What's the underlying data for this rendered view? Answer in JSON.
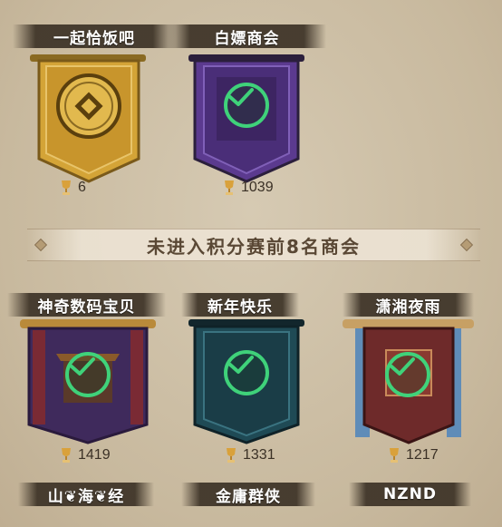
{
  "top_guilds": [
    {
      "name": "一起恰饭吧",
      "score": "6",
      "banner": "gold-coin-banner",
      "selected": false
    },
    {
      "name": "白嫖商会",
      "score": "1039",
      "banner": "purple-banner",
      "selected": true
    }
  ],
  "divider": {
    "text": "未进入积分赛前8名商会"
  },
  "other_guilds": [
    {
      "name": "神奇数码宝贝",
      "score": "1419",
      "banner": "purple-red-pavilion-banner",
      "selected": true
    },
    {
      "name": "新年快乐",
      "score": "1331",
      "banner": "teal-banner",
      "selected": true
    },
    {
      "name": "潇湘夜雨",
      "score": "1217",
      "banner": "red-blue-banner",
      "selected": true
    }
  ],
  "bottom_guilds": [
    {
      "name": "山❦海❦经"
    },
    {
      "name": "金庸群侠"
    },
    {
      "name": "NZND"
    }
  ],
  "colors": {
    "check": "#3fd27a",
    "gold": "#d4a437",
    "purple": "#5b3a8f",
    "teal": "#1f4a55",
    "red": "#6e2a2a"
  }
}
